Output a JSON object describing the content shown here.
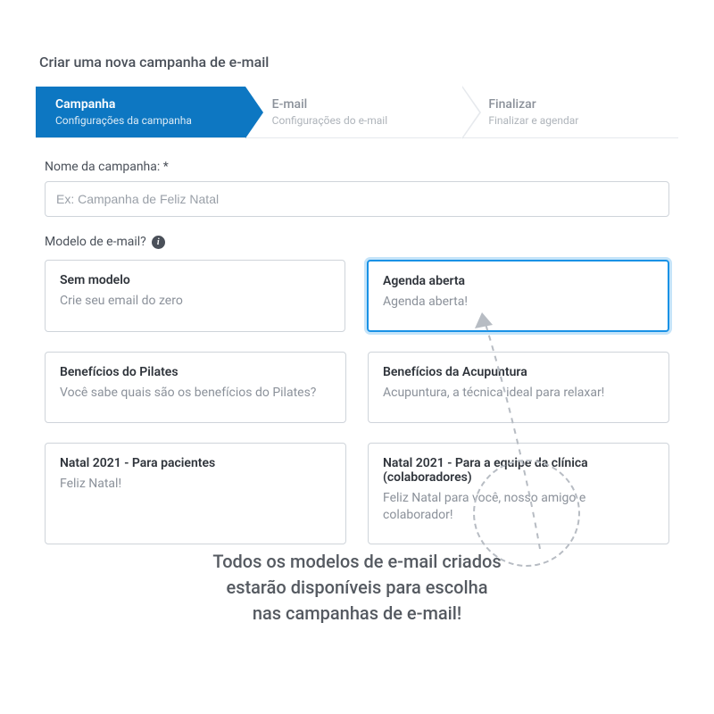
{
  "page_title": "Criar uma nova campanha de e-mail",
  "wizard": {
    "steps": [
      {
        "title": "Campanha",
        "sub": "Configurações da campanha",
        "active": true
      },
      {
        "title": "E-mail",
        "sub": "Configurações do e-mail",
        "active": false
      },
      {
        "title": "Finalizar",
        "sub": "Finalizar e agendar",
        "active": false
      }
    ]
  },
  "name_field": {
    "label": "Nome da campanha: *",
    "placeholder": "Ex: Campanha de Feliz Natal"
  },
  "template_field": {
    "label": "Modelo de e-mail?"
  },
  "templates": [
    {
      "title": "Sem modelo",
      "desc": "Crie seu email do zero",
      "selected": false
    },
    {
      "title": "Agenda aberta",
      "desc": "Agenda aberta!",
      "selected": true
    },
    {
      "title": "Benefícios do Pilates",
      "desc": "Você sabe quais são os benefícios do Pilates?",
      "selected": false
    },
    {
      "title": "Benefícios da Acupuntura",
      "desc": "Acupuntura, a técnica ideal para relaxar!",
      "selected": false
    },
    {
      "title": "Natal 2021 - Para pacientes",
      "desc": "Feliz Natal!",
      "selected": false
    },
    {
      "title": "Natal 2021 - Para a equipe da clínica (colaboradores)",
      "desc": "Feliz Natal para você, nosso amigo e colaborador!",
      "selected": false
    }
  ],
  "caption": {
    "line1": "Todos os modelos de e-mail criados",
    "line2": "estarão disponíveis para escolha",
    "line3": "nas campanhas de e-mail!"
  },
  "colors": {
    "accent": "#0d77c2",
    "selected": "#1992e6",
    "muted": "#9aa0a8"
  }
}
